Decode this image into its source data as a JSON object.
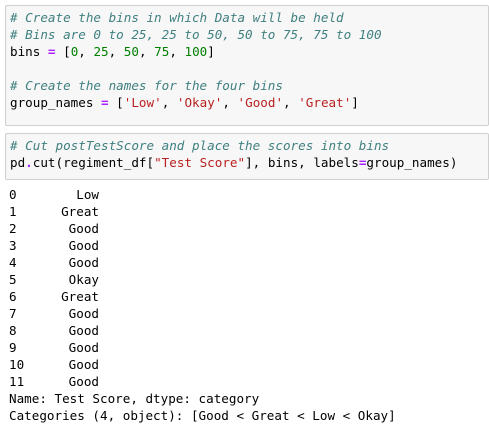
{
  "cells": [
    {
      "lines": [
        [
          {
            "t": "# Create the bins in which Data will be held",
            "c": "comment"
          }
        ],
        [
          {
            "t": "# Bins are 0 to 25, 25 to 50, 50 to 75, 75 to 100",
            "c": "comment"
          }
        ],
        [
          {
            "t": "bins ",
            "c": ""
          },
          {
            "t": "=",
            "c": "op"
          },
          {
            "t": " [",
            "c": ""
          },
          {
            "t": "0",
            "c": "num"
          },
          {
            "t": ", ",
            "c": ""
          },
          {
            "t": "25",
            "c": "num"
          },
          {
            "t": ", ",
            "c": ""
          },
          {
            "t": "50",
            "c": "num"
          },
          {
            "t": ", ",
            "c": ""
          },
          {
            "t": "75",
            "c": "num"
          },
          {
            "t": ", ",
            "c": ""
          },
          {
            "t": "100",
            "c": "num"
          },
          {
            "t": "]",
            "c": ""
          }
        ],
        [],
        [
          {
            "t": "# Create the names for the four bins",
            "c": "comment"
          }
        ],
        [
          {
            "t": "group_names ",
            "c": ""
          },
          {
            "t": "=",
            "c": "op"
          },
          {
            "t": " [",
            "c": ""
          },
          {
            "t": "'Low'",
            "c": "str"
          },
          {
            "t": ", ",
            "c": ""
          },
          {
            "t": "'Okay'",
            "c": "str"
          },
          {
            "t": ", ",
            "c": ""
          },
          {
            "t": "'Good'",
            "c": "str"
          },
          {
            "t": ", ",
            "c": ""
          },
          {
            "t": "'Great'",
            "c": "str"
          },
          {
            "t": "]",
            "c": ""
          }
        ]
      ]
    },
    {
      "lines": [
        [
          {
            "t": "# Cut postTestScore and place the scores into bins",
            "c": "comment"
          }
        ],
        [
          {
            "t": "pd",
            "c": ""
          },
          {
            "t": ".",
            "c": "op"
          },
          {
            "t": "cut(regiment_df[",
            "c": ""
          },
          {
            "t": "\"Test Score\"",
            "c": "str"
          },
          {
            "t": "], bins, labels",
            "c": ""
          },
          {
            "t": "=",
            "c": "op"
          },
          {
            "t": "group_names)",
            "c": ""
          }
        ]
      ]
    }
  ],
  "output": {
    "rows": [
      {
        "index": "0",
        "value": "Low"
      },
      {
        "index": "1",
        "value": "Great"
      },
      {
        "index": "2",
        "value": "Good"
      },
      {
        "index": "3",
        "value": "Good"
      },
      {
        "index": "4",
        "value": "Good"
      },
      {
        "index": "5",
        "value": "Okay"
      },
      {
        "index": "6",
        "value": "Great"
      },
      {
        "index": "7",
        "value": "Good"
      },
      {
        "index": "8",
        "value": "Good"
      },
      {
        "index": "9",
        "value": "Good"
      },
      {
        "index": "10",
        "value": "Good"
      },
      {
        "index": "11",
        "value": "Good"
      }
    ],
    "name_line": "Name: Test Score, dtype: category",
    "categories_line": "Categories (4, object): [Good < Great < Low < Okay]"
  },
  "colors": {
    "comment": "#408080",
    "number": "#008000",
    "string": "#ba2121",
    "operator": "#aa22ff",
    "cell_background": "#f7f7f7",
    "cell_border": "#cfcfcf"
  }
}
